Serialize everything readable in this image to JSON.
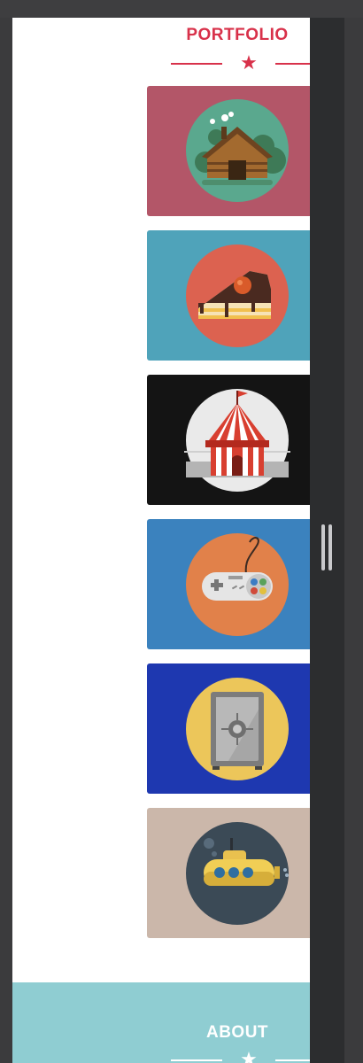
{
  "portfolio": {
    "title": "PORTFOLIO",
    "divider_icon": "star-icon",
    "items": [
      {
        "name": "log-cabin",
        "icon": "log-cabin-icon",
        "background": "#b35668",
        "circle": "#5aa88e"
      },
      {
        "name": "cake-slice",
        "icon": "cake-slice-icon",
        "background": "#4fa3ba",
        "circle": "#dc6250"
      },
      {
        "name": "circus-tent",
        "icon": "circus-tent-icon",
        "background": "#141414",
        "circle": "#eaeaea"
      },
      {
        "name": "game-controller",
        "icon": "game-controller-icon",
        "background": "#3b82be",
        "circle": "#e1814a"
      },
      {
        "name": "safe",
        "icon": "safe-icon",
        "background": "#1e38b0",
        "circle": "#ecc65a"
      },
      {
        "name": "submarine",
        "icon": "submarine-icon",
        "background": "#cbb7aa",
        "circle": "#3b4a56"
      }
    ]
  },
  "about": {
    "title": "ABOUT",
    "background": "#8fcdd2",
    "divider_icon": "star-icon"
  },
  "colors": {
    "accent": "#d8314a",
    "viewport_bg": "#ffffff",
    "chrome_bg": "#2c2d2f"
  }
}
